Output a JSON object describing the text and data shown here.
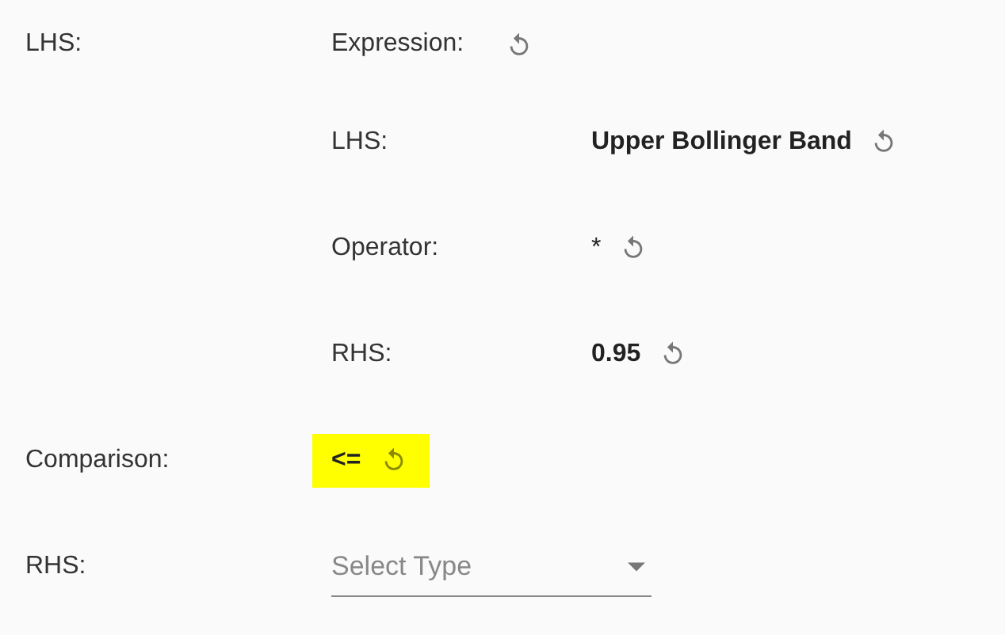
{
  "rows": [
    {
      "label": "LHS:",
      "kind": "expression",
      "expression": {
        "label": "Expression:",
        "fields": [
          {
            "label": "LHS:",
            "value": "Upper Bollinger Band",
            "bold": true
          },
          {
            "label": "Operator:",
            "value": "*",
            "bold": false
          },
          {
            "label": "RHS:",
            "value": "0.95",
            "bold": true
          }
        ]
      }
    },
    {
      "label": "Comparison:",
      "kind": "value",
      "value": "<=",
      "highlighted": true
    },
    {
      "label": "RHS:",
      "kind": "select",
      "placeholder": "Select Type"
    }
  ]
}
